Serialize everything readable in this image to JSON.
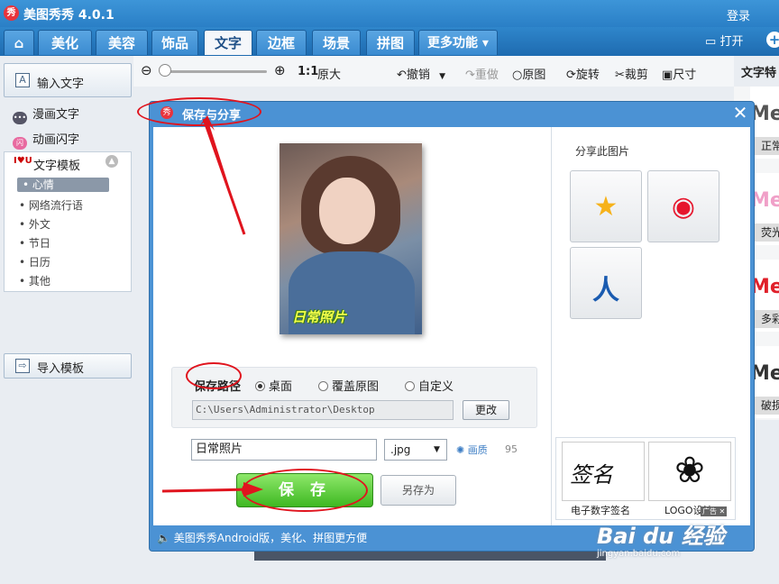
{
  "app": {
    "logo_glyph": "秀",
    "title": "美图秀秀 4.0.1",
    "login": "登录"
  },
  "tabs": [
    "美化",
    "美容",
    "饰品",
    "文字",
    "边框",
    "场景",
    "拼图",
    "更多功能 ▾"
  ],
  "active_tab": "文字",
  "header_actions": {
    "open": "打开",
    "more": "+"
  },
  "toolbar": {
    "ratio": "1:1",
    "original_size": "原大",
    "undo": "撤销",
    "redo": "重做",
    "original": "原图",
    "rotate": "旋转",
    "crop": "裁剪",
    "size": "尺寸"
  },
  "sidebar": {
    "input_text": "输入文字",
    "comic_text": "漫画文字",
    "animated_text": "动画闪字",
    "template_title": "文字模板",
    "template_categories": [
      "心情",
      "网络流行语",
      "外文",
      "节日",
      "日历",
      "其他"
    ],
    "active_category": "心情",
    "import_template": "导入模板"
  },
  "right_panel": {
    "title": "文字特",
    "cards": [
      {
        "big": "Me",
        "label": "正常",
        "color": "#555555"
      },
      {
        "big": "Me",
        "label": "荧光",
        "color": "#f0a0c8"
      },
      {
        "big": "Me",
        "label": "多彩",
        "color": "#e0202a"
      },
      {
        "big": "Me",
        "label": "破损",
        "color": "#333333"
      }
    ]
  },
  "dialog": {
    "logo_glyph": "秀",
    "title": "保存与分享",
    "close": "✕",
    "photo_caption": "日常照片",
    "save_path_label": "保存路径",
    "radios": [
      {
        "label": "桌面",
        "selected": true
      },
      {
        "label": "覆盖原图",
        "selected": false
      },
      {
        "label": "自定义",
        "selected": false
      }
    ],
    "path_value": "C:\\Users\\Administrator\\Desktop",
    "change_button": "更改",
    "filename_value": "日常照片",
    "extension_value": ".jpg",
    "quality_label": "画质",
    "quality_value": "95",
    "save_button": "保 存",
    "save_as_button": "另存为",
    "share_title": "分享此图片",
    "share_targets": [
      {
        "icon": "qzone-icon",
        "glyph": "★",
        "color": "#f6b21a"
      },
      {
        "icon": "weibo-icon",
        "glyph": "◉",
        "color": "#e6162d"
      },
      {
        "icon": "renren-icon",
        "glyph": "人",
        "color": "#1a5bb0"
      }
    ],
    "ads": [
      {
        "label": "电子数字签名",
        "glyph": "签名"
      },
      {
        "label": "LOGO设计",
        "glyph": "❀"
      }
    ],
    "ad_tag": "广告 ✕",
    "status_text": "美图秀秀Android版，美化、拼图更方便"
  },
  "watermark": {
    "main": "Bai du 经验",
    "sub": "jingyan.baidu.com"
  }
}
